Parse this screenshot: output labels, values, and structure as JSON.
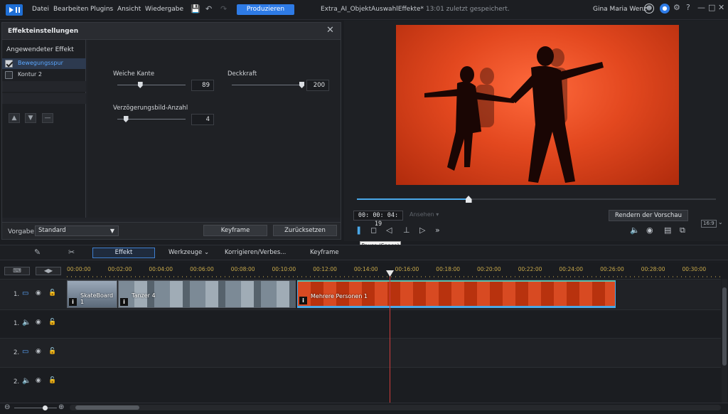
{
  "menubar": {
    "menus": [
      "Datei",
      "Bearbeiten",
      "Plugins",
      "Ansicht",
      "Wiedergabe"
    ],
    "produce_label": "Produzieren",
    "project_name": "Extra_AI_ObjektAuswahlEffekte*",
    "saved_status": "13:01 zuletzt gespeichert.",
    "user_name": "Gina Maria Wenz"
  },
  "effects_panel": {
    "title": "Effekteinstellungen",
    "applied_label": "Angewendeter Effekt",
    "effects": [
      {
        "label": "Bewegungsspur",
        "checked": true,
        "selected": true
      },
      {
        "label": "Kontur 2",
        "checked": false,
        "selected": false
      }
    ],
    "params": {
      "soft_edge": {
        "label": "Weiche Kante",
        "value": "89",
        "fraction": 0.33
      },
      "opacity": {
        "label": "Deckkraft",
        "value": "200",
        "fraction": 1.0
      },
      "delay_count": {
        "label": "Verzögerungsbild-Anzahl",
        "value": "4",
        "fraction": 0.12
      }
    },
    "preset_label": "Vorgabe:",
    "preset_value": "Standard",
    "keyframe_button": "Keyframe",
    "reset_button": "Zurücksetzen"
  },
  "preview": {
    "timecode": "00: 00: 04: 19",
    "view_label": "Ansehen",
    "render_button": "Rendern der Vorschau",
    "aspect_ratio": "16:9",
    "progress": 0.31,
    "tooltip": "Pause (Space)"
  },
  "toolbar": {
    "effect_button": "Effekt",
    "tools_label": "Werkzeuge",
    "correct_label": "Korrigieren/Verbes...",
    "keyframe_label": "Keyframe"
  },
  "ruler_ticks": [
    "00:00:00",
    "00:02:00",
    "00:04:00",
    "00:06:00",
    "00:08:00",
    "00:10:00",
    "00:12:00",
    "00:14:00",
    "00:16:00",
    "00:18:00",
    "00:20:00",
    "00:22:00",
    "00:24:00",
    "00:26:00",
    "00:28:00",
    "00:30:00"
  ],
  "tracks": [
    {
      "num": "1.",
      "type": "video"
    },
    {
      "num": "1.",
      "type": "audio"
    },
    {
      "num": "2.",
      "type": "video"
    },
    {
      "num": "2.",
      "type": "audio"
    }
  ],
  "clips": [
    {
      "name": "SkateBoard 1",
      "badge": "i"
    },
    {
      "name": "Tanzer 4",
      "badge": "i"
    },
    {
      "name": "Mehrere Personen 1",
      "badge": "i"
    }
  ],
  "colors": {
    "accent": "#2e7be6",
    "selection": "#5aa7ff",
    "playhead": "#d03c3c"
  }
}
